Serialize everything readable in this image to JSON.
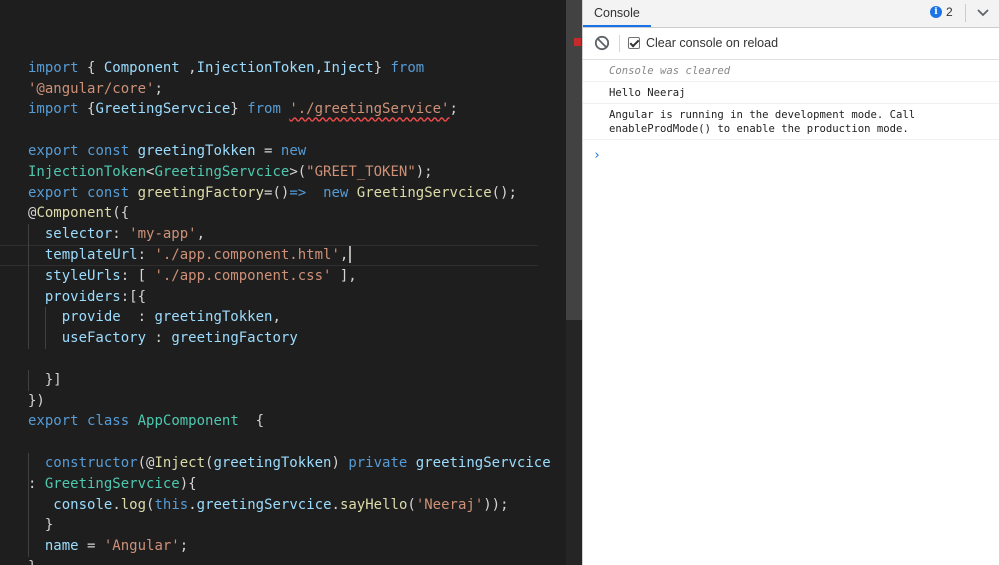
{
  "editor": {
    "lines": [
      [],
      [
        {
          "c": "k",
          "t": "import"
        },
        {
          "c": "p",
          "t": " { "
        },
        {
          "c": "v",
          "t": "Component"
        },
        {
          "c": "p",
          "t": " ,"
        },
        {
          "c": "v",
          "t": "InjectionToken"
        },
        {
          "c": "p",
          "t": ","
        },
        {
          "c": "v",
          "t": "Inject"
        },
        {
          "c": "p",
          "t": "} "
        },
        {
          "c": "k",
          "t": "from"
        }
      ],
      [
        {
          "c": "s",
          "t": "'@angular/core'"
        },
        {
          "c": "p",
          "t": ";"
        }
      ],
      [
        {
          "c": "k",
          "t": "import"
        },
        {
          "c": "p",
          "t": " {"
        },
        {
          "c": "v",
          "t": "GreetingServcice"
        },
        {
          "c": "p",
          "t": "} "
        },
        {
          "c": "k",
          "t": "from"
        },
        {
          "c": "p",
          "t": " "
        },
        {
          "c": "s squiggle",
          "t": "'./greetingService'"
        },
        {
          "c": "p",
          "t": ";"
        }
      ],
      [],
      [
        {
          "c": "k",
          "t": "export"
        },
        {
          "c": "p",
          "t": " "
        },
        {
          "c": "k",
          "t": "const"
        },
        {
          "c": "p",
          "t": " "
        },
        {
          "c": "v",
          "t": "greetingTokken"
        },
        {
          "c": "p",
          "t": " = "
        },
        {
          "c": "k",
          "t": "new"
        }
      ],
      [
        {
          "c": "t",
          "t": "InjectionToken"
        },
        {
          "c": "p",
          "t": "<"
        },
        {
          "c": "t",
          "t": "GreetingServcice"
        },
        {
          "c": "p",
          "t": ">("
        },
        {
          "c": "s",
          "t": "\"GREET_TOKEN\""
        },
        {
          "c": "p",
          "t": ");"
        }
      ],
      [
        {
          "c": "k",
          "t": "export"
        },
        {
          "c": "p",
          "t": " "
        },
        {
          "c": "k",
          "t": "const"
        },
        {
          "c": "p",
          "t": " "
        },
        {
          "c": "f",
          "t": "greetingFactory"
        },
        {
          "c": "p",
          "t": "=()"
        },
        {
          "c": "k",
          "t": "=>"
        },
        {
          "c": "p",
          "t": "  "
        },
        {
          "c": "k",
          "t": "new"
        },
        {
          "c": "p",
          "t": " "
        },
        {
          "c": "f",
          "t": "GreetingServcice"
        },
        {
          "c": "p",
          "t": "();"
        }
      ],
      [
        {
          "c": "p",
          "t": "@"
        },
        {
          "c": "f",
          "t": "Component"
        },
        {
          "c": "p",
          "t": "({"
        }
      ],
      [
        {
          "c": "p",
          "t": "  "
        },
        {
          "c": "v",
          "t": "selector"
        },
        {
          "c": "p",
          "t": ": "
        },
        {
          "c": "s",
          "t": "'my-app'"
        },
        {
          "c": "p",
          "t": ","
        }
      ],
      [
        {
          "c": "p",
          "t": "  "
        },
        {
          "c": "v",
          "t": "templateUrl"
        },
        {
          "c": "p",
          "t": ": "
        },
        {
          "c": "s",
          "t": "'./app.component.html'"
        },
        {
          "c": "p",
          "t": ","
        }
      ],
      [
        {
          "c": "p",
          "t": "  "
        },
        {
          "c": "v",
          "t": "styleUrls"
        },
        {
          "c": "p",
          "t": ": [ "
        },
        {
          "c": "s",
          "t": "'./app.component.css'"
        },
        {
          "c": "p",
          "t": " ],"
        }
      ],
      [
        {
          "c": "p",
          "t": "  "
        },
        {
          "c": "v",
          "t": "providers"
        },
        {
          "c": "p",
          "t": ":[{"
        }
      ],
      [
        {
          "c": "p",
          "t": "    "
        },
        {
          "c": "v",
          "t": "provide"
        },
        {
          "c": "p",
          "t": "  : "
        },
        {
          "c": "v",
          "t": "greetingTokken"
        },
        {
          "c": "p",
          "t": ","
        }
      ],
      [
        {
          "c": "p",
          "t": "    "
        },
        {
          "c": "v",
          "t": "useFactory"
        },
        {
          "c": "p",
          "t": " : "
        },
        {
          "c": "v",
          "t": "greetingFactory"
        }
      ],
      [],
      [
        {
          "c": "p",
          "t": "  }]"
        }
      ],
      [
        {
          "c": "p",
          "t": "})"
        }
      ],
      [
        {
          "c": "k",
          "t": "export"
        },
        {
          "c": "p",
          "t": " "
        },
        {
          "c": "k",
          "t": "class"
        },
        {
          "c": "p",
          "t": " "
        },
        {
          "c": "t",
          "t": "AppComponent"
        },
        {
          "c": "p",
          "t": "  {"
        }
      ],
      [],
      [
        {
          "c": "p",
          "t": "  "
        },
        {
          "c": "k",
          "t": "constructor"
        },
        {
          "c": "p",
          "t": "(@"
        },
        {
          "c": "f",
          "t": "Inject"
        },
        {
          "c": "p",
          "t": "("
        },
        {
          "c": "v",
          "t": "greetingTokken"
        },
        {
          "c": "p",
          "t": ") "
        },
        {
          "c": "k",
          "t": "private"
        },
        {
          "c": "p",
          "t": " "
        },
        {
          "c": "v",
          "t": "greetingServcice"
        }
      ],
      [
        {
          "c": "p",
          "t": ": "
        },
        {
          "c": "t",
          "t": "GreetingServcice"
        },
        {
          "c": "p",
          "t": "){"
        }
      ],
      [
        {
          "c": "p",
          "t": "   "
        },
        {
          "c": "v",
          "t": "console"
        },
        {
          "c": "p",
          "t": "."
        },
        {
          "c": "f",
          "t": "log"
        },
        {
          "c": "p",
          "t": "("
        },
        {
          "c": "k",
          "t": "this"
        },
        {
          "c": "p",
          "t": "."
        },
        {
          "c": "v",
          "t": "greetingServcice"
        },
        {
          "c": "p",
          "t": "."
        },
        {
          "c": "f",
          "t": "sayHello"
        },
        {
          "c": "p",
          "t": "("
        },
        {
          "c": "s",
          "t": "'Neeraj'"
        },
        {
          "c": "p",
          "t": "));"
        }
      ],
      [
        {
          "c": "p",
          "t": "  }"
        }
      ],
      [
        {
          "c": "p",
          "t": "  "
        },
        {
          "c": "v",
          "t": "name"
        },
        {
          "c": "p",
          "t": " = "
        },
        {
          "c": "s",
          "t": "'Angular'"
        },
        {
          "c": "p",
          "t": ";"
        }
      ],
      [
        {
          "c": "p",
          "t": "}"
        }
      ]
    ]
  },
  "console": {
    "tab_label": "Console",
    "info_count": "2",
    "info_icon_glyph": "i",
    "clear_on_reload_label": "Clear console on reload",
    "messages": [
      {
        "text": "Console was cleared",
        "kind": "cleared"
      },
      {
        "text": "Hello Neeraj",
        "kind": "log"
      },
      {
        "text": "Angular is running in the development mode. Call\nenableProdMode() to enable the production mode.",
        "kind": "log"
      }
    ],
    "prompt_glyph": "›"
  },
  "colors": {
    "editor_bg": "#1e1e1e",
    "keyword": "#569cd6",
    "string": "#ce9178",
    "type": "#4ec9b0",
    "variable": "#9cdcfe",
    "function": "#dcdcaa",
    "accent": "#1a73e8",
    "error": "#f14c4c"
  }
}
